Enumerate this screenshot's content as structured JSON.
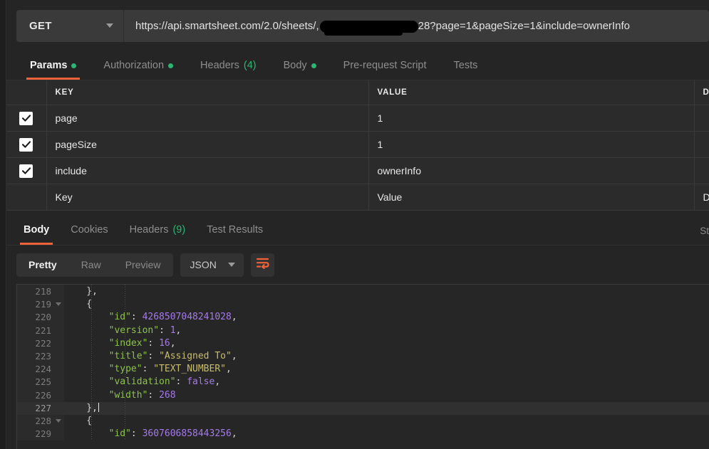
{
  "request": {
    "method": "GET",
    "method_caret_icon": "chevron-down-icon",
    "url_prefix": "https://api.smartsheet.com/2.0/sheets/,",
    "url_redacted": "",
    "url_suffix": "28?page=1&pageSize=1&include=ownerInfo"
  },
  "request_tabs": [
    {
      "label": "Params",
      "badge": "dot",
      "active": true
    },
    {
      "label": "Authorization",
      "badge": "dot",
      "active": false
    },
    {
      "label": "Headers",
      "count": "(4)",
      "active": false
    },
    {
      "label": "Body",
      "badge": "dot",
      "active": false
    },
    {
      "label": "Pre-request Script",
      "active": false
    },
    {
      "label": "Tests",
      "active": false
    }
  ],
  "params_table": {
    "headers": {
      "key": "KEY",
      "value": "VALUE",
      "description": "DES"
    },
    "rows": [
      {
        "checked": true,
        "key": "page",
        "value": "1",
        "desc": ""
      },
      {
        "checked": true,
        "key": "pageSize",
        "value": "1",
        "desc": ""
      },
      {
        "checked": true,
        "key": "include",
        "value": "ownerInfo",
        "desc": ""
      }
    ],
    "placeholder_row": {
      "key": "Key",
      "value": "Value",
      "desc": "De"
    }
  },
  "response_tabs": [
    {
      "label": "Body",
      "active": true
    },
    {
      "label": "Cookies",
      "active": false
    },
    {
      "label": "Headers",
      "count": "(9)",
      "active": false
    },
    {
      "label": "Test Results",
      "active": false
    }
  ],
  "response_status_cut": "St",
  "format_toolbar": {
    "view_modes": [
      {
        "label": "Pretty",
        "active": true
      },
      {
        "label": "Raw",
        "active": false
      },
      {
        "label": "Preview",
        "active": false
      }
    ],
    "language": "JSON",
    "language_caret_icon": "chevron-down-icon",
    "wrap_button_icon": "word-wrap-icon"
  },
  "code": {
    "lines": [
      {
        "num": "218",
        "fold": false,
        "cur": false,
        "indent": 0,
        "tokens": [
          {
            "t": "p",
            "v": "    },"
          }
        ]
      },
      {
        "num": "219",
        "fold": true,
        "cur": false,
        "indent": 0,
        "tokens": [
          {
            "t": "p",
            "v": "    {"
          }
        ]
      },
      {
        "num": "220",
        "fold": false,
        "cur": false,
        "indent": 0,
        "tokens": [
          {
            "t": "k",
            "v": "        \"id\""
          },
          {
            "t": "p",
            "v": ": "
          },
          {
            "t": "n",
            "v": "4268507048241028"
          },
          {
            "t": "p",
            "v": ","
          }
        ]
      },
      {
        "num": "221",
        "fold": false,
        "cur": false,
        "indent": 0,
        "tokens": [
          {
            "t": "k",
            "v": "        \"version\""
          },
          {
            "t": "p",
            "v": ": "
          },
          {
            "t": "n",
            "v": "1"
          },
          {
            "t": "p",
            "v": ","
          }
        ]
      },
      {
        "num": "222",
        "fold": false,
        "cur": false,
        "indent": 0,
        "tokens": [
          {
            "t": "k",
            "v": "        \"index\""
          },
          {
            "t": "p",
            "v": ": "
          },
          {
            "t": "n",
            "v": "16"
          },
          {
            "t": "p",
            "v": ","
          }
        ]
      },
      {
        "num": "223",
        "fold": false,
        "cur": false,
        "indent": 0,
        "tokens": [
          {
            "t": "k",
            "v": "        \"title\""
          },
          {
            "t": "p",
            "v": ": "
          },
          {
            "t": "s",
            "v": "\"Assigned To\""
          },
          {
            "t": "p",
            "v": ","
          }
        ]
      },
      {
        "num": "224",
        "fold": false,
        "cur": false,
        "indent": 0,
        "tokens": [
          {
            "t": "k",
            "v": "        \"type\""
          },
          {
            "t": "p",
            "v": ": "
          },
          {
            "t": "s",
            "v": "\"TEXT_NUMBER\""
          },
          {
            "t": "p",
            "v": ","
          }
        ]
      },
      {
        "num": "225",
        "fold": false,
        "cur": false,
        "indent": 0,
        "tokens": [
          {
            "t": "k",
            "v": "        \"validation\""
          },
          {
            "t": "p",
            "v": ": "
          },
          {
            "t": "n",
            "v": "false"
          },
          {
            "t": "p",
            "v": ","
          }
        ]
      },
      {
        "num": "226",
        "fold": false,
        "cur": false,
        "indent": 0,
        "tokens": [
          {
            "t": "k",
            "v": "        \"width\""
          },
          {
            "t": "p",
            "v": ": "
          },
          {
            "t": "n",
            "v": "268"
          }
        ]
      },
      {
        "num": "227",
        "fold": false,
        "cur": true,
        "indent": 0,
        "tokens": [
          {
            "t": "p",
            "v": "    },"
          },
          {
            "t": "caret",
            "v": ""
          }
        ]
      },
      {
        "num": "228",
        "fold": true,
        "cur": false,
        "indent": 0,
        "tokens": [
          {
            "t": "p",
            "v": "    {"
          }
        ]
      },
      {
        "num": "229",
        "fold": false,
        "cur": false,
        "indent": 0,
        "tokens": [
          {
            "t": "k",
            "v": "        \"id\""
          },
          {
            "t": "p",
            "v": ": "
          },
          {
            "t": "n",
            "v": "3607606858443256"
          },
          {
            "t": "p",
            "v": ","
          }
        ]
      }
    ]
  },
  "colors": {
    "accent": "#f0623a",
    "ok_dot": "#2bb673",
    "json_key": "#8bc34a",
    "json_number": "#a57ae8",
    "json_string": "#c8bd6c",
    "bg": "#252525"
  }
}
